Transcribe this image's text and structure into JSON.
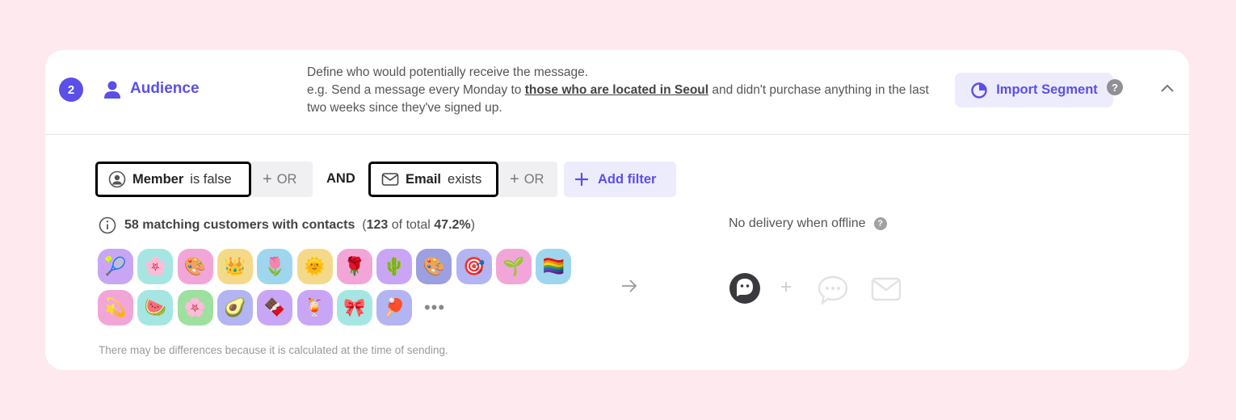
{
  "header": {
    "step_number": "2",
    "title": "Audience",
    "description_line1": "Define who would potentially receive the message.",
    "description_pre": "e.g. Send a message every Monday to ",
    "description_highlight": "those who are located in Seoul",
    "description_post": " and didn't purchase anything in the last two weeks since they've signed up.",
    "import_button_label": "Import Segment",
    "help_label": "?"
  },
  "filters": {
    "group1": {
      "field": "Member",
      "operator": "is false",
      "or_label": "OR"
    },
    "connector": "AND",
    "group2": {
      "field": "Email",
      "operator": "exists",
      "or_label": "OR"
    },
    "add_filter_label": "Add filter"
  },
  "match": {
    "summary": "58 matching customers with contacts",
    "open_paren": "(",
    "matched": "123",
    "of_total_label": "of total",
    "percent": "47.2%",
    "close_paren": ")"
  },
  "offline": {
    "label": "No delivery when offline",
    "help_label": "?"
  },
  "avatars": [
    {
      "glyph": "🎾",
      "bg": "#c8a6f5"
    },
    {
      "glyph": "🌸",
      "bg": "#a6e6e2"
    },
    {
      "glyph": "🎨",
      "bg": "#f2a6d8"
    },
    {
      "glyph": "👑",
      "bg": "#f5d98a"
    },
    {
      "glyph": "🌷",
      "bg": "#9ed6f0"
    },
    {
      "glyph": "🌞",
      "bg": "#f5d98a"
    },
    {
      "glyph": "🌹",
      "bg": "#f2a6d8"
    },
    {
      "glyph": "🌵",
      "bg": "#c8a6f5"
    },
    {
      "glyph": "🎨",
      "bg": "#9c9fe0"
    },
    {
      "glyph": "🎯",
      "bg": "#b3b4f2"
    },
    {
      "glyph": "🌱",
      "bg": "#f2a6d8"
    },
    {
      "glyph": "🏳️‍🌈",
      "bg": "#9ed6f0"
    },
    {
      "glyph": "💫",
      "bg": "#f2a6d8"
    },
    {
      "glyph": "🍉",
      "bg": "#a6e6e2"
    },
    {
      "glyph": "🌸",
      "bg": "#9ee0a0"
    },
    {
      "glyph": "🥑",
      "bg": "#b3b4f2"
    },
    {
      "glyph": "🍫",
      "bg": "#c8a6f5"
    },
    {
      "glyph": "🍹",
      "bg": "#c8a6f5"
    },
    {
      "glyph": "🎀",
      "bg": "#a6e6e2"
    },
    {
      "glyph": "🏓",
      "bg": "#b3b4f2"
    }
  ],
  "more_label": "•••",
  "channels": [
    "bot-icon",
    "chat-bubble-icon",
    "mail-icon"
  ],
  "plus_separator": "+",
  "footnote": "There may be differences because it is calculated at the time of sending.",
  "colors": {
    "accent": "#5b4fe8",
    "accent_soft": "#ececfd",
    "page_bg": "#fde9ee"
  }
}
